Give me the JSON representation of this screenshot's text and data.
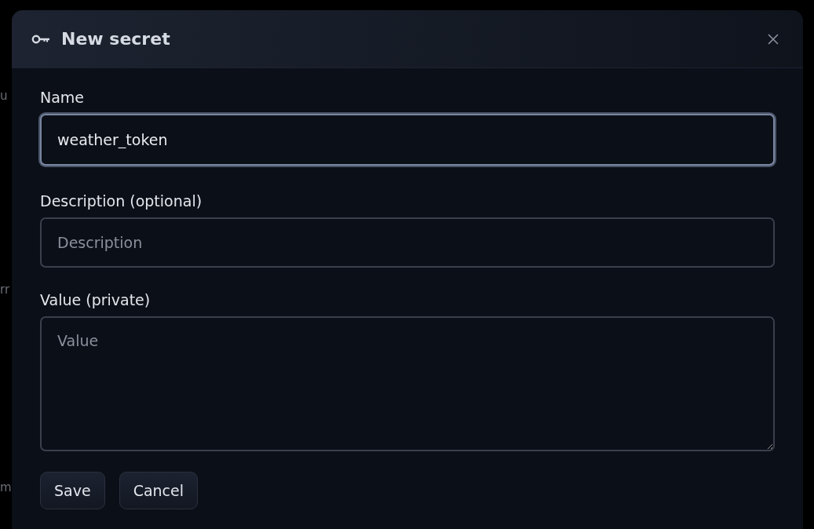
{
  "background_fragments": [
    "u",
    "rr",
    "m"
  ],
  "dialog": {
    "title": "New secret"
  },
  "fields": [
    {
      "kind": "input",
      "label": "Name",
      "value": "weather_token",
      "focused": true
    },
    {
      "kind": "input",
      "label": "Description (optional)",
      "placeholder": "Description",
      "focused": false
    },
    {
      "kind": "textarea",
      "label": "Value (private)",
      "placeholder": "Value",
      "focused": false
    }
  ],
  "buttons": [
    "Save",
    "Cancel"
  ]
}
